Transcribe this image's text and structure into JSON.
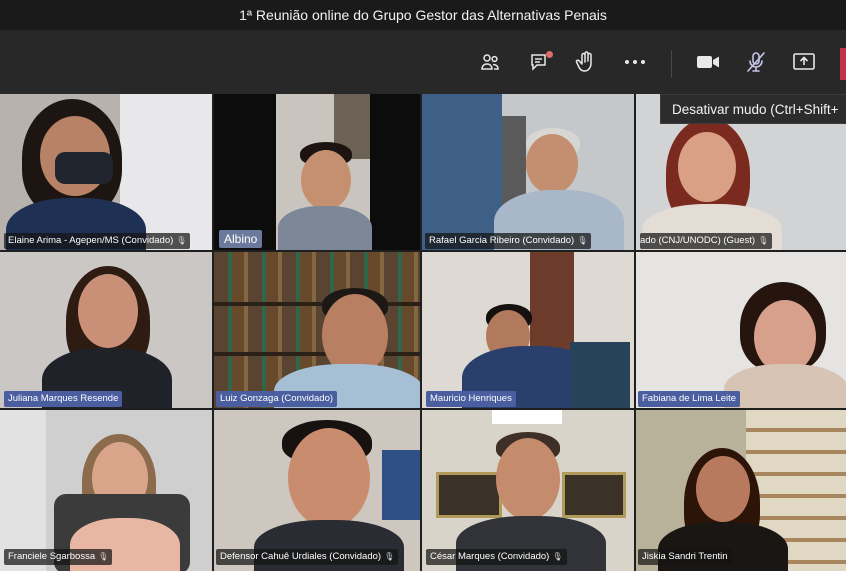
{
  "window": {
    "title": "1ª Reunião online do Grupo Gestor das Alternativas Penais"
  },
  "toolbar": {
    "buttons": [
      {
        "name": "participants-icon"
      },
      {
        "name": "chat-icon",
        "has_notification": true
      },
      {
        "name": "raise-hand-icon"
      },
      {
        "name": "more-actions-icon"
      },
      {
        "name": "camera-icon"
      },
      {
        "name": "mic-muted-icon"
      },
      {
        "name": "share-screen-icon"
      }
    ],
    "accent_color": "#e06c6c",
    "end_call_color": "#c4314b"
  },
  "tooltip": {
    "text": "Desativar mudo (Ctrl+Shift+"
  },
  "participants": [
    {
      "label": "Elaine Arima - Agepen/MS (Convidado)",
      "mic": true
    },
    {
      "label": "Albino",
      "mic": false
    },
    {
      "label": "Rafael Garcia Ribeiro (Convidado)",
      "mic": true
    },
    {
      "label": "ado (CNJ/UNODC) (Guest)",
      "mic": true
    },
    {
      "label": "Juliana Marques Resende",
      "mic": false
    },
    {
      "label": "Luiz Gonzaga (Convidado)",
      "mic": false
    },
    {
      "label": "Mauricio Henriques",
      "mic": false
    },
    {
      "label": "Fabiana de Lima Leite",
      "mic": false
    },
    {
      "label": "Franciele Sgarbossa",
      "mic": true
    },
    {
      "label": "Defensor Cahuê Urdiales (Convidado)",
      "mic": true
    },
    {
      "label": "César Marques (Convidado)",
      "mic": true
    },
    {
      "label": "Jiskia Sandri Trentin",
      "mic": false
    }
  ],
  "icons": {
    "mic": "🎙"
  }
}
